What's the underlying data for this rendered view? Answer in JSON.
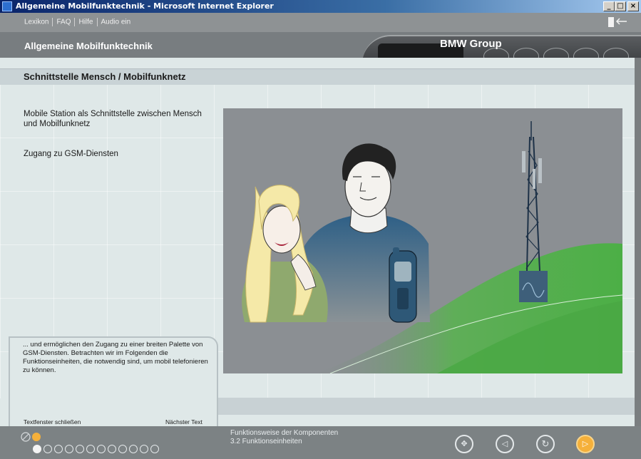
{
  "window": {
    "title": "Allgemeine Mobilfunktechnik - Microsoft Internet Explorer"
  },
  "menu": {
    "items": [
      "Lexikon",
      "FAQ",
      "Hilfe",
      "Audio ein"
    ]
  },
  "header": {
    "app_title": "Allgemeine Mobilfunktechnik",
    "brand": "BMW Group"
  },
  "section": {
    "title": "Schnittstelle Mensch / Mobilfunknetz"
  },
  "main": {
    "bullet1": "Mobile Station als Schnittstelle zwischen Mensch und Mobilfunknetz",
    "bullet2": "Zugang zu GSM-Diensten"
  },
  "textbox": {
    "text": "... und ermöglichen den Zugang zu einer breiten Palette von GSM-Diensten. Betrachten wir im Folgenden die Funktionseinheiten, die notwendig sind, um mobil telefonieren zu können.",
    "close_label": "Textfenster schließen",
    "next_label": "Nächster Text"
  },
  "footer": {
    "chapter": "Funktionsweise der Komponenten",
    "subchapter": "3.2 Funktionseinheiten",
    "progress": {
      "current": 1,
      "total": 12
    }
  },
  "colors": {
    "accent": "#f5b03a",
    "footer": "#7c8284",
    "header": "#787d80"
  },
  "icons": [
    "app-icon",
    "minimize-icon",
    "maximize-icon",
    "close-icon",
    "exit-icon",
    "check-icon",
    "navigation-cross-icon",
    "back-arrow-icon",
    "replay-icon",
    "forward-arrow-icon"
  ]
}
